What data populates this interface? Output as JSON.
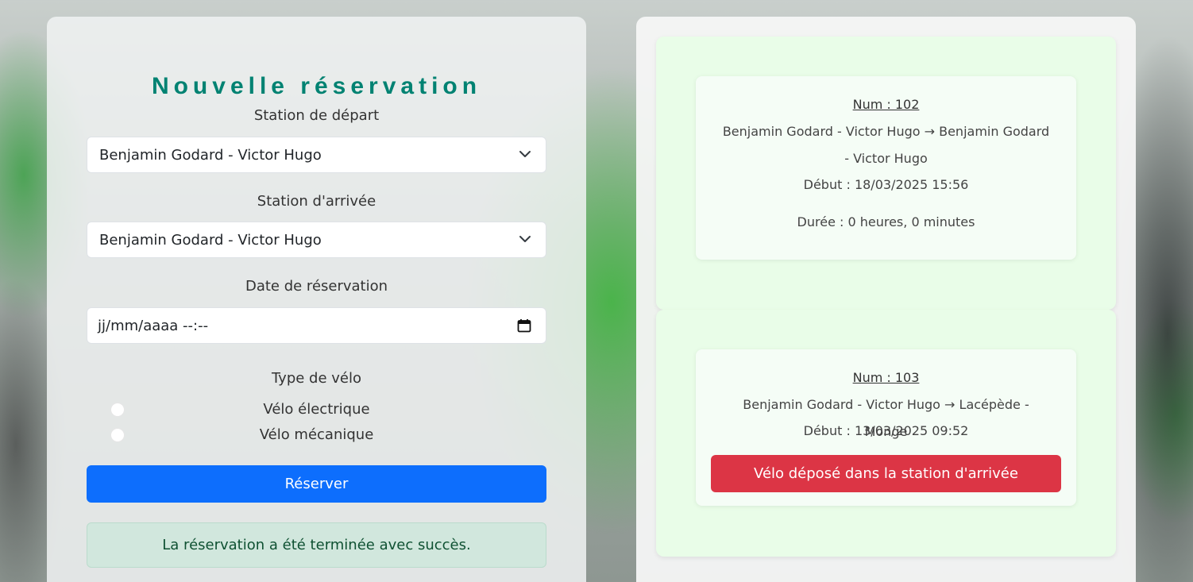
{
  "form": {
    "title": "Nouvelle réservation",
    "departure_label": "Station de départ",
    "departure_value": "Benjamin Godard - Victor Hugo",
    "arrival_label": "Station d'arrivée",
    "arrival_value": "Benjamin Godard - Victor Hugo",
    "date_label": "Date de réservation",
    "date_placeholder": "jj/mm/aaaa --:--",
    "bike_type_label": "Type de vélo",
    "bike_options": [
      "Vélo électrique",
      "Vélo mécanique"
    ],
    "submit_label": "Réserver",
    "success_message": "La réservation a été terminée avec succès."
  },
  "reservations": [
    {
      "num": "Num : 102",
      "route": "Benjamin Godard - Victor Hugo → Benjamin Godard - Victor Hugo",
      "start": "Début : 18/03/2025 15:56",
      "duration": "Durée : 0 heures, 0 minutes"
    },
    {
      "num": "Num : 103",
      "route": "Benjamin Godard - Victor Hugo → Lacépède - Monge",
      "start": "Début : 13/03/2025 09:52",
      "action_label": "Vélo déposé dans la station d'arrivée"
    }
  ],
  "colors": {
    "title": "#008272",
    "primary": "#0d6efd",
    "danger": "#dc3545",
    "success_bg": "#d1e7dd",
    "card_bg": "#e9fde8"
  },
  "icons": {
    "select": "chevron-down-icon",
    "date": "calendar-icon"
  }
}
